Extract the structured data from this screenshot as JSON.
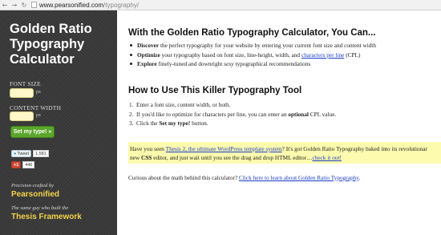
{
  "browser": {
    "url_domain": "www.pearsonified.com",
    "url_path": "/typography/"
  },
  "sidebar": {
    "title": "Golden Ratio\nTypography\nCalculator",
    "font_size_label": "FONT SIZE",
    "font_size_unit": "px",
    "content_width_label": "CONTENT WIDTH",
    "content_width_unit": "px",
    "submit_label": "Set my type! »",
    "tweet_label": "Tweet",
    "tweet_count": "1,581",
    "gplus_label": "+1",
    "gplus_count": "446",
    "credit_line_1": "Precision-crafted by",
    "credit_name_1": "Pearsonified",
    "credit_line_2": "The same guy who built the",
    "credit_name_2": "Thesis Framework",
    "accent_color": "#f3d24b",
    "button_color": "#5aa62c"
  },
  "main": {
    "heading_1": "With the Golden Ratio Typography Calculator, You Can...",
    "bullets": [
      {
        "bold": "Discover",
        "text": " the perfect typography for your website by entering your current font size and content width"
      },
      {
        "bold": "Optimize",
        "text": " your typography based on font size, line-height, width, and ",
        "link": "characters per line",
        "after": " (CPL)"
      },
      {
        "bold": "Explore",
        "text": " finely-tuned and downright ",
        "italic": "sexy",
        "after": " typographical recommendations"
      }
    ],
    "heading_2": "How to Use This Killer Typography Tool",
    "steps": [
      {
        "num": "1.",
        "text": "Enter a font size, content width, or both."
      },
      {
        "num": "2.",
        "text": "If you'd like to optimize for characters per line, you can enter an ",
        "bold": "optional",
        "after": " CPL value."
      },
      {
        "num": "3.",
        "text": "Click the ",
        "bold": "Set my type!",
        "after": " button."
      }
    ],
    "promo": {
      "pre": "Have you seen ",
      "link_1": "Thesis 2, the ultimate WordPress template system",
      "mid_1": "? It's got Golden Ratio Typography baked into its revolutionar",
      "line2_pre": "new ",
      "bold": "CSS",
      "mid_2": " editor, and just wait until you see the drag and drop HTML editor…",
      "link_2": "check it out!"
    },
    "curious": {
      "pre": "Curious about the math behind this calculator? ",
      "link": "Click here to learn about Golden Ratio Typography",
      "after": "."
    }
  }
}
